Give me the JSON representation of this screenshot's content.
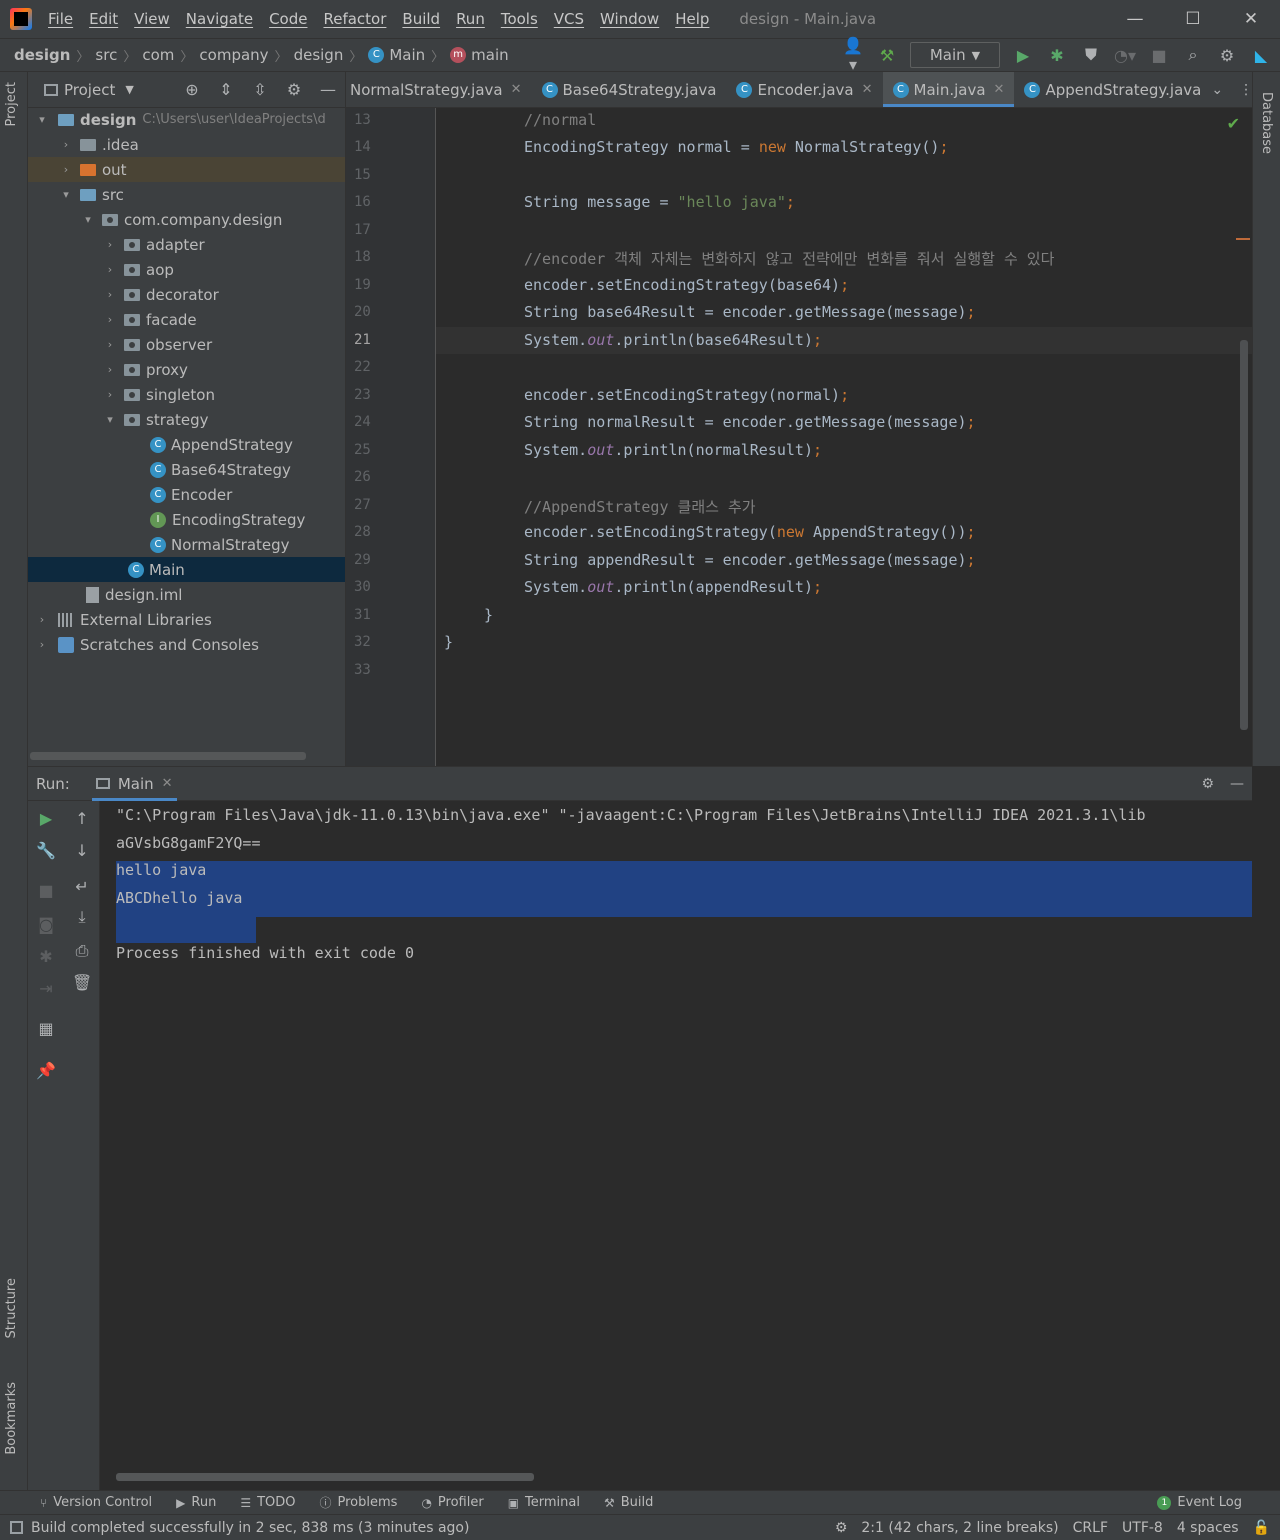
{
  "window": {
    "title": "design - Main.java",
    "menu": [
      "File",
      "Edit",
      "View",
      "Navigate",
      "Code",
      "Refactor",
      "Build",
      "Run",
      "Tools",
      "VCS",
      "Window",
      "Help"
    ],
    "controls": [
      "—",
      "☐",
      "✕"
    ]
  },
  "breadcrumbs": {
    "items": [
      "design",
      "src",
      "com",
      "company",
      "design",
      "Main",
      "main"
    ],
    "separator": "〉"
  },
  "toolbar": {
    "run_config": "Main"
  },
  "side_tabs": {
    "project": "Project",
    "structure": "Structure",
    "bookmarks": "Bookmarks",
    "database": "Database"
  },
  "project_panel": {
    "title": "Project",
    "tree": [
      {
        "label": "design",
        "path": "C:\\Users\\user\\IdeaProjects\\d"
      },
      {
        "label": ".idea"
      },
      {
        "label": "out"
      },
      {
        "label": "src"
      },
      {
        "label": "com.company.design"
      },
      {
        "label": "adapter"
      },
      {
        "label": "aop"
      },
      {
        "label": "decorator"
      },
      {
        "label": "facade"
      },
      {
        "label": "observer"
      },
      {
        "label": "proxy"
      },
      {
        "label": "singleton"
      },
      {
        "label": "strategy"
      },
      {
        "label": "AppendStrategy"
      },
      {
        "label": "Base64Strategy"
      },
      {
        "label": "Encoder"
      },
      {
        "label": "EncodingStrategy"
      },
      {
        "label": "NormalStrategy"
      },
      {
        "label": "Main"
      },
      {
        "label": "design.iml"
      },
      {
        "label": "External Libraries"
      },
      {
        "label": "Scratches and Consoles"
      }
    ]
  },
  "editor_tabs": [
    {
      "label": "NormalStrategy.java"
    },
    {
      "label": "Base64Strategy.java"
    },
    {
      "label": "Encoder.java"
    },
    {
      "label": "Main.java",
      "active": true
    },
    {
      "label": "AppendStrategy.java"
    }
  ],
  "editor": {
    "current_line": 21,
    "line_numbers": [
      "13",
      "14",
      "15",
      "16",
      "17",
      "18",
      "19",
      "20",
      "21",
      "22",
      "23",
      "24",
      "25",
      "26",
      "27",
      "28",
      "29",
      "30",
      "31",
      "32",
      "33"
    ],
    "lines": {
      "l13": "//normal",
      "l14a": "EncodingStrategy normal = ",
      "l14b": "new",
      "l14c": " NormalStrategy()",
      "l14d": ";",
      "l16a": "String message = ",
      "l16b": "\"hello java\"",
      "l16c": ";",
      "l18": "//encoder 객체 자체는 변화하지 않고 전략에만 변화를 줘서 실행할 수 있다",
      "l19a": "encoder.setEncodingStrategy(base64)",
      "l19b": ";",
      "l20a": "String base64Result = encoder.getMessage(message)",
      "l20b": ";",
      "l21a": "System.",
      "l21b": "out",
      "l21c": ".println(base64Result)",
      "l21d": ";",
      "l23a": "encoder.setEncodingStrategy(normal)",
      "l23b": ";",
      "l24a": "String normalResult = encoder.getMessage(message)",
      "l24b": ";",
      "l25a": "System.",
      "l25b": "out",
      "l25c": ".println(normalResult)",
      "l25d": ";",
      "l27": "//AppendStrategy 클래스 추가",
      "l28a": "encoder.setEncodingStrategy(",
      "l28b": "new",
      "l28c": " AppendStrategy())",
      "l28d": ";",
      "l29a": "String appendResult = encoder.getMessage(message)",
      "l29b": ";",
      "l30a": "System.",
      "l30b": "out",
      "l30c": ".println(appendResult)",
      "l30d": ";",
      "l31": "}",
      "l32": "}"
    }
  },
  "run_panel": {
    "label": "Run:",
    "tab": "Main",
    "console": [
      "\"C:\\Program Files\\Java\\jdk-11.0.13\\bin\\java.exe\" \"-javaagent:C:\\Program Files\\JetBrains\\IntelliJ IDEA 2021.3.1\\lib",
      "aGVsbG8gamF2YQ==",
      "hello java",
      "ABCDhello java",
      "",
      "Process finished with exit code 0"
    ]
  },
  "bottom_tabs": [
    "Version Control",
    "Run",
    "TODO",
    "Problems",
    "Profiler",
    "Terminal",
    "Build"
  ],
  "event_log": {
    "label": "Event Log",
    "count": "1"
  },
  "status": {
    "message": "Build completed successfully in 2 sec, 838 ms (3 minutes ago)",
    "position": "2:1 (42 chars, 2 line breaks)",
    "line_sep": "CRLF",
    "encoding": "UTF-8",
    "indent": "4 spaces"
  },
  "colors": {
    "keyword": "#cc7832",
    "string": "#6a8759",
    "comment": "#808080",
    "static_field": "#9876aa",
    "selection": "#214283",
    "accent": "#4a88c7"
  }
}
